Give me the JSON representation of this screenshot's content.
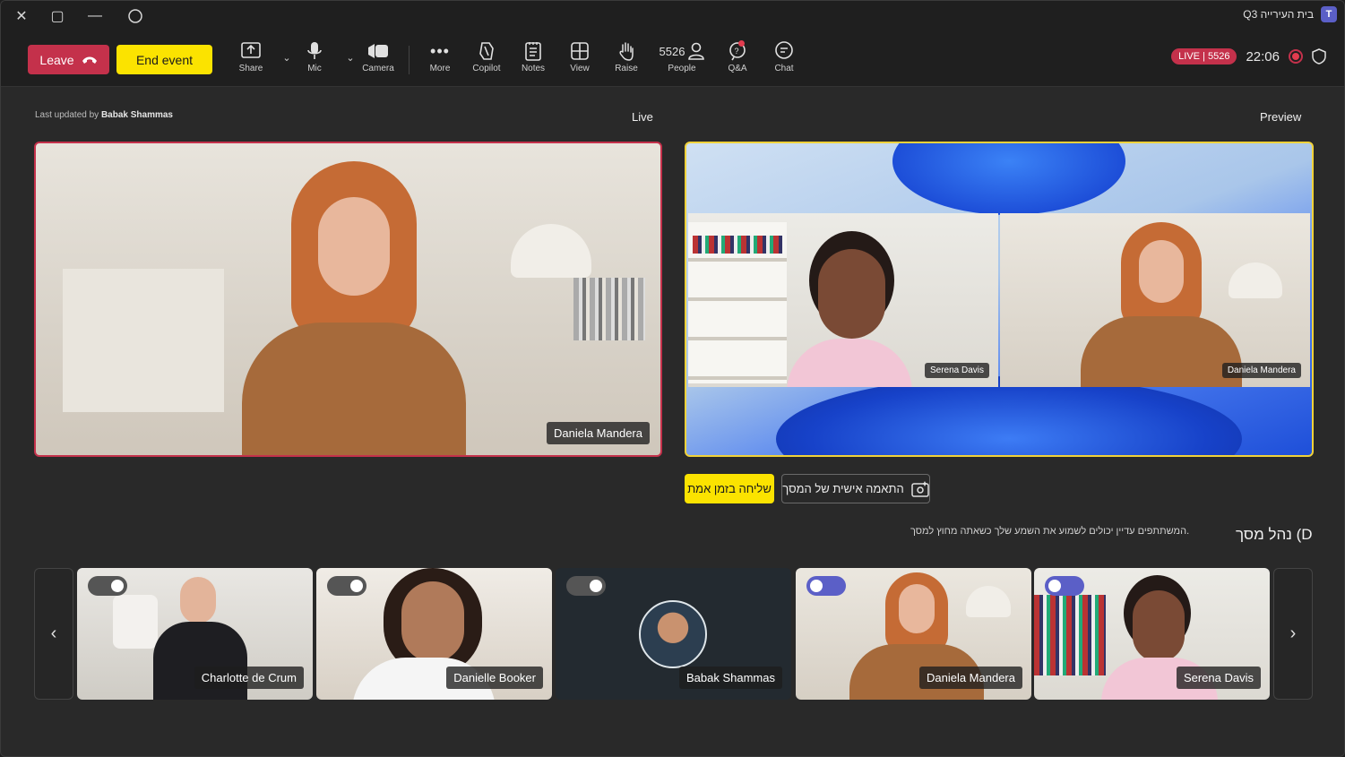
{
  "window": {
    "title": "Q3 בית העירייה",
    "app_icon": "teams-logo",
    "controls": [
      "close-icon",
      "maximize-icon",
      "minimize-icon",
      "circle-icon"
    ]
  },
  "toolbar": {
    "leave_label": "Leave",
    "end_event_label": "End event",
    "share_label": "Share",
    "mic_label": "Mic",
    "camera_label": "Camera",
    "more_label": "More",
    "copilot_label": "Copilot",
    "notes_label": "Notes",
    "view_label": "View",
    "raise_label": "Raise",
    "people_label": "People",
    "people_count": "5526",
    "qa_label": "Q&A",
    "chat_label": "Chat",
    "live_badge": "LIVE | 5526",
    "timer": "22:06"
  },
  "stage": {
    "live_label": "Live",
    "preview_label": "Preview",
    "last_updated_prefix": "Last updated by",
    "last_updated_by": "Babak Shammas",
    "live_name": "Daniela Mandera",
    "preview_names": [
      "Serena Davis",
      "Daniela Mandera"
    ]
  },
  "actions": {
    "send_live": "שליחה בזמן אמת",
    "customize": "התאמה אישית של המסך"
  },
  "manage": {
    "title": "נהל מסך (D",
    "note": "המשתתפים עדיין יכולים לשמוע את השמע שלך כשאתה מחוץ למסך."
  },
  "participants": [
    {
      "name": "Serena Davis",
      "toggle_on": true
    },
    {
      "name": "Daniela Mandera",
      "toggle_on": true
    },
    {
      "name": "Babak Shammas",
      "toggle_on": false
    },
    {
      "name": "Danielle Booker",
      "toggle_on": false
    },
    {
      "name": "Charlotte de Crum",
      "toggle_on": false
    }
  ],
  "colors": {
    "accent_live": "#c4314b",
    "accent_yellow": "#fbe300",
    "accent_toggle": "#5b5fc7"
  }
}
